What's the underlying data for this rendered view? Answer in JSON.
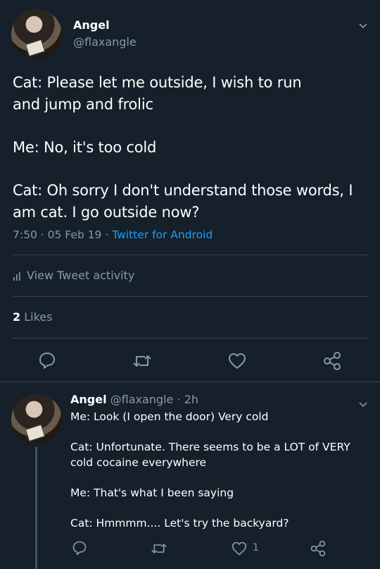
{
  "tweet": {
    "author_name": "Angel",
    "author_handle": "@flaxangle",
    "lines": [
      "Cat: Please let me outside, I wish to run",
      "and jump and frolic",
      "Me: No, it's too cold",
      "Cat: Oh sorry I don't understand those words, I",
      "am cat. I go outside now?"
    ],
    "time": "7:50",
    "date": "05 Feb 19",
    "sep": "·",
    "source": "Twitter for Android",
    "activity_label": "View Tweet activity",
    "likes_count": "2",
    "likes_label": "Likes"
  },
  "reply": {
    "author_name": "Angel",
    "author_handle": "@flaxangle",
    "age": "2h",
    "sep": "·",
    "lines": [
      "Me: Look (I open the door) Very cold",
      "Cat: Unfortunate. There seems to be a LOT of VERY",
      "cold cocaine everywhere",
      "Me: That's what I been saying",
      "Cat: Hmmmm.... Let's try the backyard?"
    ],
    "like_count": "1"
  },
  "icons": {
    "chevron": "chevron-down-icon",
    "reply": "reply-icon",
    "retweet": "retweet-icon",
    "like": "heart-icon",
    "share": "share-icon",
    "activity": "bar-chart-icon"
  },
  "colors": {
    "background": "#15202b",
    "muted": "#8899a6",
    "link": "#1da1f2",
    "divider": "#38444d"
  }
}
